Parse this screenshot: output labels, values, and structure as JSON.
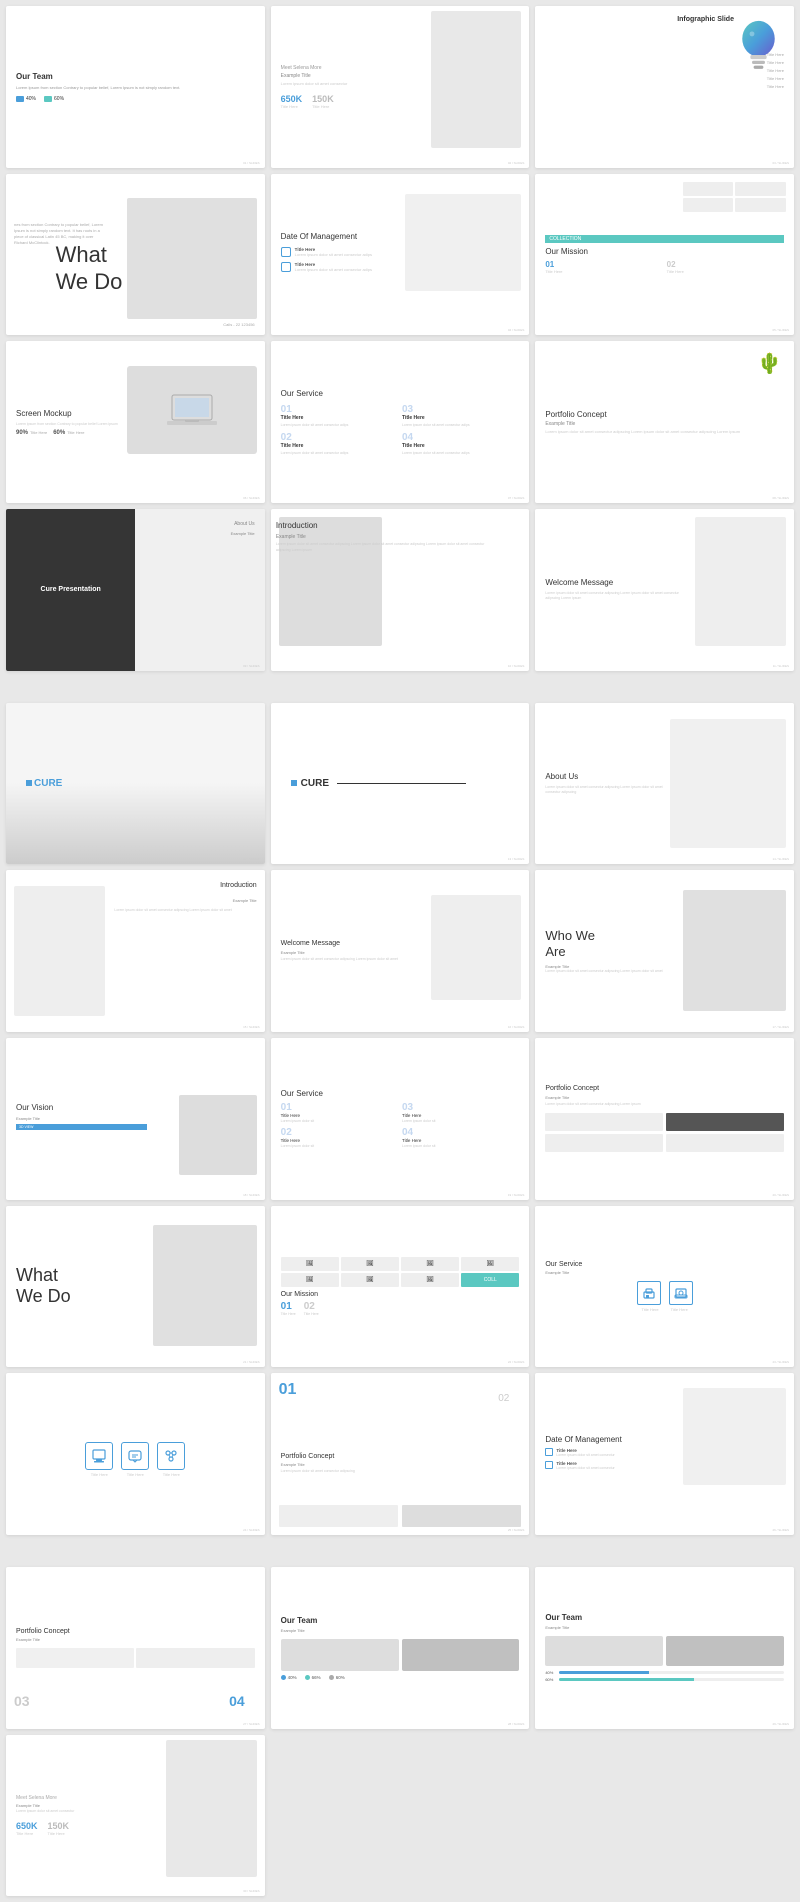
{
  "slides": {
    "row1": [
      {
        "id": "our-team",
        "title": "Our Team",
        "body": "Lorem Ipsum from section Contrary to popular belief, Lorem Ipsum is not simply random text.",
        "stat1": "40%",
        "stat2": "60%"
      },
      {
        "id": "meet-selena",
        "sub": "Meet Selena More",
        "example_title": "Example Title",
        "lorem": "Lorem ipsum dolor sit amet consectur",
        "num1": "650K",
        "num1_label": "Title Here",
        "num2": "150K",
        "num2_label": "Title Here"
      },
      {
        "id": "infographic",
        "title": "Infographic Slide",
        "labels": [
          "Title Here",
          "Title Here",
          "Title Here",
          "Title Here",
          "Title Here"
        ]
      }
    ],
    "row2": [
      {
        "id": "what-we-do-large",
        "title": "What\nWe Do",
        "side_text": "nes from section Contrary to popular belief, Lorem Ipsum is not simply random text. It has roots in a piece of classical Latin 45 BC, making it over Richard McClintock.",
        "contact": "Calls - 22 123456"
      },
      {
        "id": "date-management",
        "title": "Date Of Management",
        "item1": "Title Here",
        "item1_text": "Lorem ipsum dolor sit amet consectur adips",
        "item2": "Title Here",
        "item2_text": "Lorem ipsum dolor sit amet consectur adips"
      },
      {
        "id": "our-mission-1",
        "badge": "COLLECTION",
        "title": "Our Mission",
        "num1": "01",
        "text1": "Title Here",
        "num2": "02",
        "text2": "Title Here"
      }
    ],
    "row3": [
      {
        "id": "screen-mockup",
        "title": "Screen Mockup",
        "desc": "Lorem ipsum from section Contrary to popular belief Lorem ipsum",
        "stat1_val": "90%",
        "stat1_label": "Title Here",
        "stat2_val": "60%",
        "stat2_label": "Title Here"
      },
      {
        "id": "our-service-mid",
        "title": "Our Service",
        "s1_num": "01",
        "s1_title": "Title Here",
        "s1_text": "Lorem ipsum dolor sit amet consectur adips",
        "s2_num": "02",
        "s2_title": "Title Here",
        "s2_text": "Lorem ipsum dolor sit amet consectur adips",
        "s3_num": "03",
        "s3_title": "Title Here",
        "s3_text": "Lorem ipsum dolor sit amet consectur adips",
        "s4_num": "04",
        "s4_title": "Title Here",
        "s4_text": "Lorem ipsum dolor sit amet consectur adips"
      },
      {
        "id": "portfolio-concept",
        "title": "Portfolio Concept",
        "example": "Example Title",
        "desc": "Lorem ipsum dolor sit amet consectur adipscing Lorem ipsum dolor sit amet consectur adipscing Lorem ipsum"
      }
    ],
    "row4": [
      {
        "id": "about-us",
        "overlay_text": "Cure Presentation",
        "title": "Introduction"
      },
      {
        "id": "introduction",
        "title": "Introduction",
        "example": "Example Title",
        "body": "Lorem ipsum dolor sit amet consectur adipscing Lorem ipsum dolor sit amet consectur adipscing Lorem ipsum dolor sit amet consectur adipscing Lorem ipsum"
      },
      {
        "id": "welcome-message",
        "title": "Welcome Message",
        "body": "Lorem ipsum dolor sit amet consectur adipscing Lorem ipsum dolor sit amet consectur adipscing Lorem ipsum"
      }
    ],
    "row5": [
      {
        "id": "cure-cover",
        "cure_text": "CURE"
      },
      {
        "id": "cure-cover2",
        "cure_text": "CURE"
      },
      {
        "id": "about-us2",
        "title": "About Us",
        "body": "Lorem ipsum dolor sit amet consectur adipscing Lorem ipsum dolor sit amet consectur adipscing"
      },
      {
        "id": "intro2",
        "title": "Introduction",
        "example": "Example Title",
        "body": "Lorem ipsum dolor sit amet consectur adipscing Lorem ipsum dolor sit amet"
      }
    ],
    "row6": [
      {
        "id": "welcome2",
        "title": "Welcome Message",
        "example": "Example Title",
        "body": "Lorem ipsum dolor sit amet consectur adipscing Lorem ipsum dolor sit amet"
      },
      {
        "id": "who-we-are",
        "title": "Who We\nAre",
        "example": "Example Title",
        "body": "Lorem ipsum dolor sit amet consectur adipscing Lorem ipsum dolor sit amet"
      },
      {
        "id": "our-vision",
        "title": "Our Vision",
        "example": "Example Title",
        "bar_text": "3D VIEW"
      },
      {
        "id": "our-service2",
        "title": "Our Service",
        "s1_num": "01",
        "s2_num": "02",
        "s3_num": "03",
        "s4_num": "04",
        "s1_title": "Title Here",
        "s2_title": "Title Here",
        "s3_title": "Title Here",
        "s4_title": "Title Here"
      }
    ],
    "row7": [
      {
        "id": "portfolio2",
        "title": "Portfolio Concept",
        "example": "Example Title",
        "body": "Lorem ipsum dolor sit amet consectur adipscing Lorem ipsum"
      },
      {
        "id": "what-we-do2",
        "title": "What\nWe Do"
      },
      {
        "id": "our-mission2",
        "badge": "COLLECTION",
        "title": "Our Mission",
        "num1": "01",
        "num2": "02"
      },
      {
        "id": "our-service3",
        "title": "Our Service",
        "example": "Example Title",
        "icon1": "⬡",
        "icon2": "🖨",
        "title1": "Title Here",
        "title2": "Title Here"
      }
    ],
    "row8": [
      {
        "id": "service-icons",
        "icon1": "💼",
        "icon2": "💬",
        "icon3": "⚙",
        "label1": "Title Here",
        "label2": "Title Here",
        "label3": "Title Here"
      },
      {
        "id": "portfolio3",
        "num_big": "01",
        "num_big2": "02",
        "title": "Portfolio Concept",
        "example": "Example Title",
        "body": "Lorem ipsum dolor sit amet consectur adipscing"
      },
      {
        "id": "date-mgmt2",
        "title": "Date Of Management",
        "item1": "Title Here",
        "item1_text": "Lorem ipsum dolor sit amet consectur",
        "item2": "Title Here",
        "item2_text": "Lorem ipsum dolor sit amet consectur"
      }
    ],
    "row9": [
      {
        "id": "portfolio4",
        "num03": "03",
        "num04": "04",
        "title": "Portfolio Concept",
        "example": "Example Title"
      },
      {
        "id": "our-team2",
        "title": "Our Team",
        "example": "Example Title",
        "stat1": "40%",
        "stat2": "66%",
        "stat3": "60%"
      },
      {
        "id": "our-team3",
        "title": "Our Team",
        "example": "Example Title",
        "stat1": "40%",
        "stat2": "60%"
      },
      {
        "id": "meet-selena2",
        "sub": "Meet Selena More",
        "example": "Example Title",
        "lorem": "Lorem ipsum dolor sit amet consectur",
        "num1": "650K",
        "num2": "150K"
      }
    ]
  },
  "colors": {
    "accent": "#4a9eda",
    "teal": "#5bc8c1",
    "text_light": "#999",
    "text_placeholder": "#ccc"
  }
}
